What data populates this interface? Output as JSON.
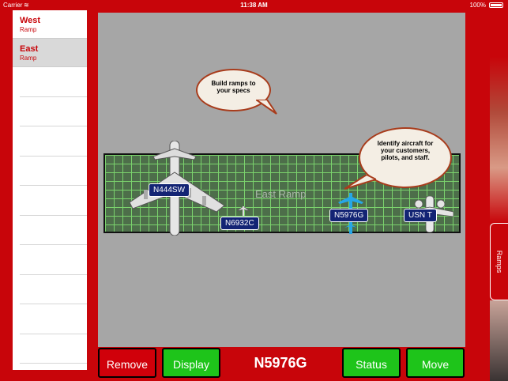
{
  "status_bar": {
    "carrier": "Carrier",
    "time": "11:38 AM",
    "battery": "100%"
  },
  "sidebar": {
    "items": [
      {
        "title": "West",
        "subtitle": "Ramp"
      },
      {
        "title": "East",
        "subtitle": "Ramp"
      }
    ]
  },
  "ramp": {
    "name": "East Ramp"
  },
  "bubbles": {
    "build": "Build ramps to your specs",
    "identify": "Identify aircraft for your customers, pilots, and staff."
  },
  "aircraft": [
    {
      "tail": "N444SW"
    },
    {
      "tail": "N6932C"
    },
    {
      "tail": "N5976G"
    },
    {
      "tail": "USN T"
    }
  ],
  "toolbar": {
    "remove": "Remove",
    "display": "Display",
    "selected": "N5976G",
    "status": "Status",
    "move": "Move"
  },
  "side_tab": {
    "label": "Ramps"
  },
  "colors": {
    "background": "#c8050a",
    "canvas": "#a6a6a6",
    "grid": "#7bd36d",
    "tag": "#132474",
    "green_button": "#1ec41a",
    "red_button": "#d0000a"
  }
}
